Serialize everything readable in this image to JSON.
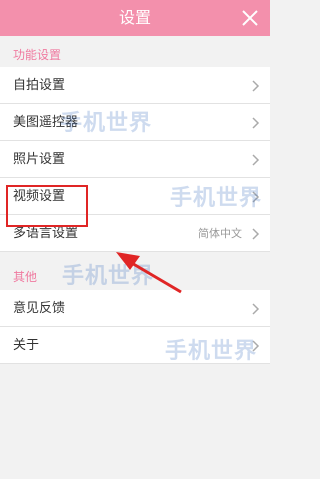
{
  "header": {
    "title": "设置",
    "close_icon": "close-icon"
  },
  "sections": [
    {
      "label": "功能设置",
      "items": [
        {
          "label": "自拍设置",
          "value": ""
        },
        {
          "label": "美图遥控器",
          "value": ""
        },
        {
          "label": "照片设置",
          "value": ""
        },
        {
          "label": "视频设置",
          "value": ""
        },
        {
          "label": "多语言设置",
          "value": "简体中文"
        }
      ]
    },
    {
      "label": "其他",
      "items": [
        {
          "label": "意见反馈",
          "value": ""
        },
        {
          "label": "关于",
          "value": ""
        }
      ]
    }
  ],
  "watermark": {
    "text": "手机世界"
  },
  "colors": {
    "accent": "#f390ac",
    "section_label": "#f07aa0",
    "annotation": "#e02525"
  }
}
